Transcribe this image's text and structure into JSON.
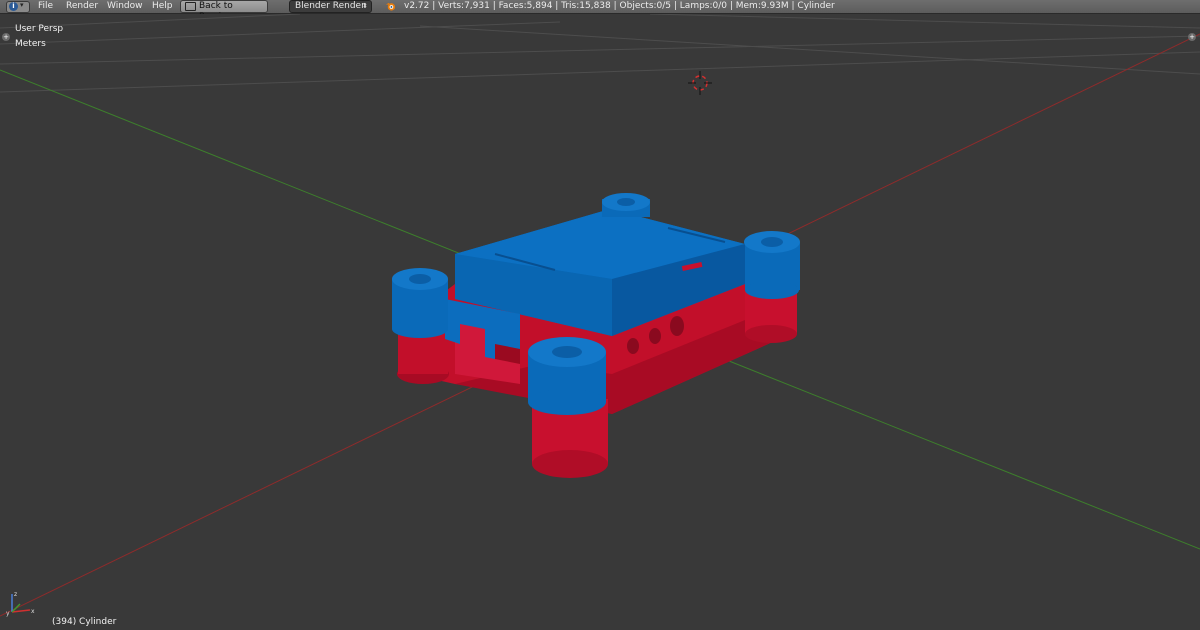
{
  "topbar": {
    "info_icon": "info-icon",
    "menus": [
      "File",
      "Render",
      "Window",
      "Help"
    ],
    "back_button_label": "Back to Previous",
    "render_engine": "Blender Render",
    "stats": "v2.72 | Verts:7,931 | Faces:5,894 | Tris:15,838 | Objects:0/5 | Lamps:0/0 | Mem:9.93M | Cylinder"
  },
  "viewport": {
    "view_name": "User Persp",
    "units": "Meters",
    "active_object": "(394) Cylinder"
  },
  "colors": {
    "background": "#393939",
    "grid": "#4a4a4a",
    "x_axis": "#9a2a2a",
    "y_axis": "#3f8a2f",
    "model_top": "#0a66b8",
    "model_bottom": "#c8102e"
  }
}
